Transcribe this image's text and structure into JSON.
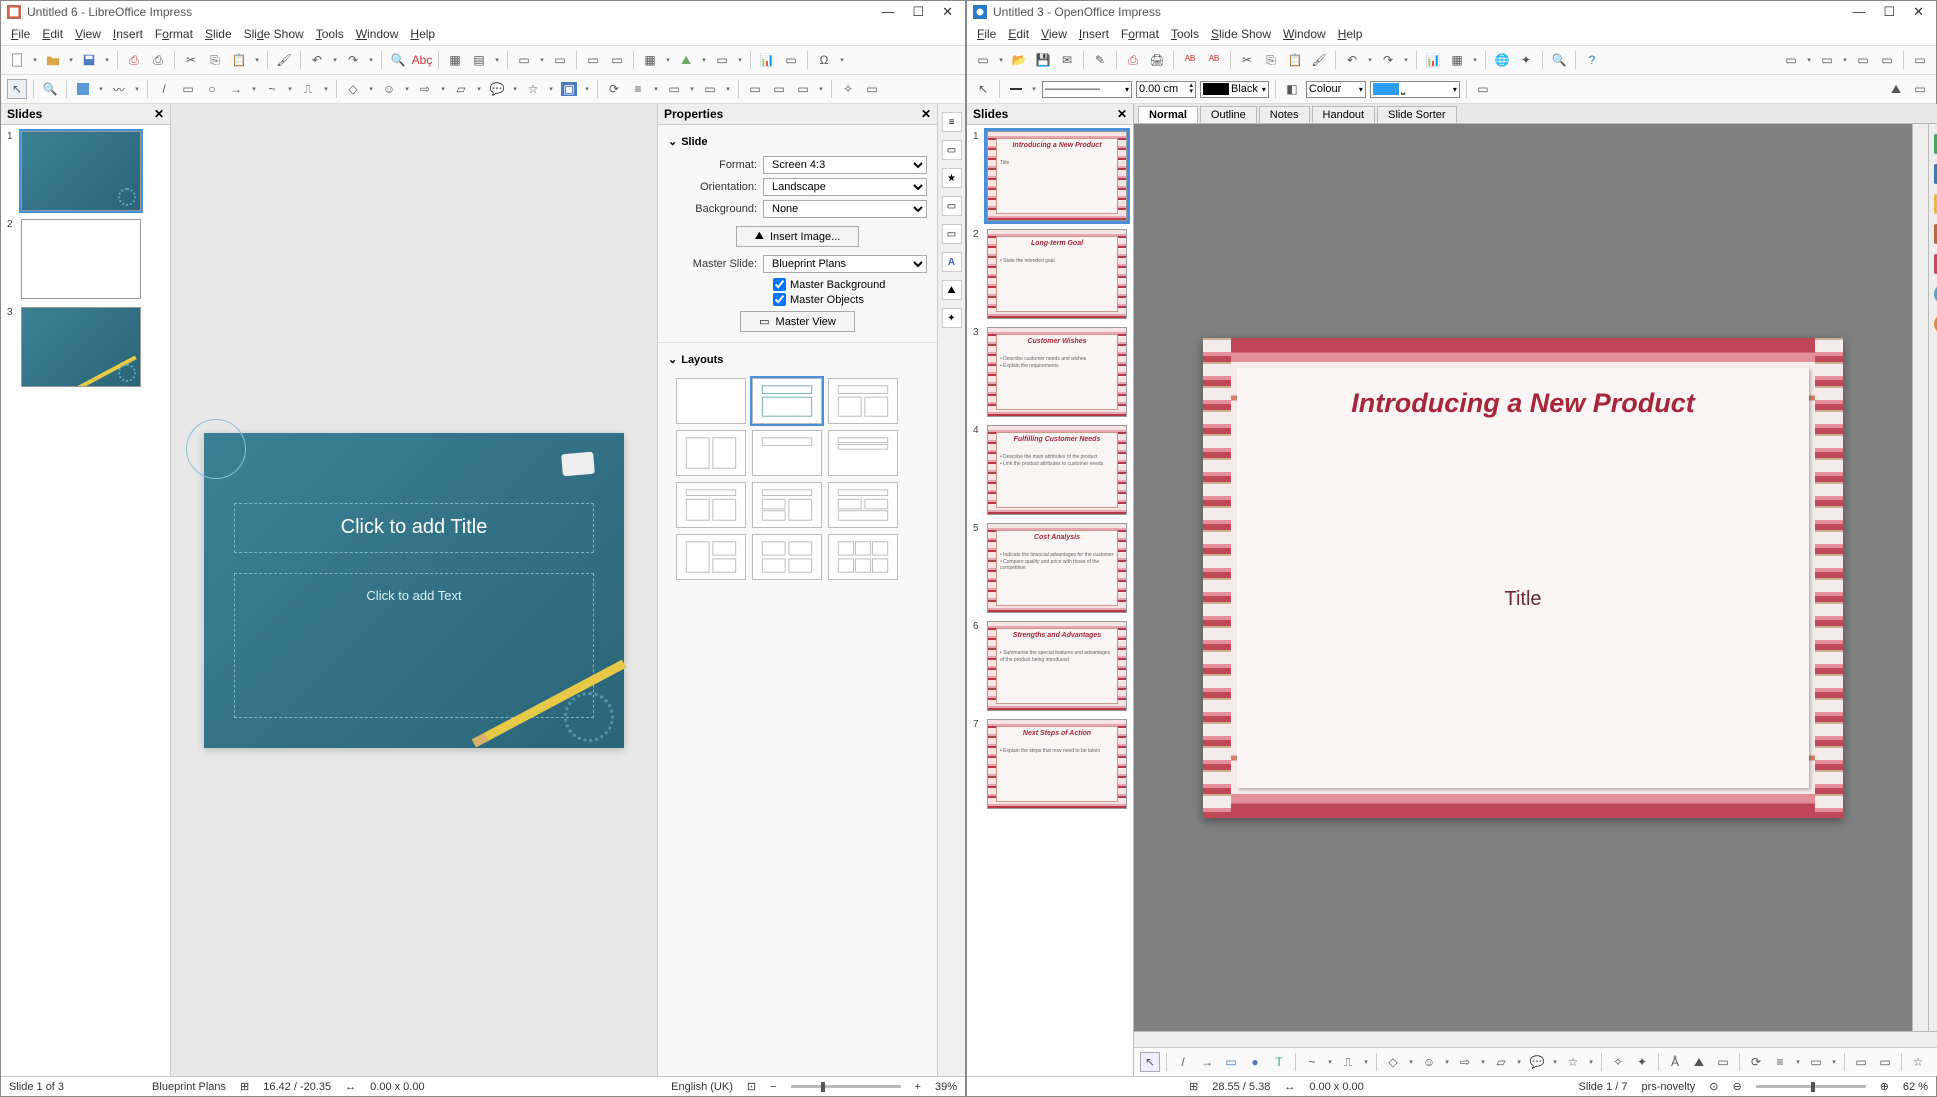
{
  "left": {
    "title": "Untitled 6 - LibreOffice Impress",
    "menu": [
      "File",
      "Edit",
      "View",
      "Insert",
      "Format",
      "Slide",
      "Slide Show",
      "Tools",
      "Window",
      "Help"
    ],
    "slides_panel_title": "Slides",
    "slide_count": 3,
    "canvas": {
      "title_ph": "Click to add Title",
      "text_ph": "Click to add Text"
    },
    "properties": {
      "panel_title": "Properties",
      "slide_section": "Slide",
      "format_label": "Format:",
      "format_value": "Screen 4:3",
      "orientation_label": "Orientation:",
      "orientation_value": "Landscape",
      "background_label": "Background:",
      "background_value": "None",
      "insert_image": "Insert Image...",
      "master_slide_label": "Master Slide:",
      "master_slide_value": "Blueprint Plans",
      "master_bg": "Master Background",
      "master_obj": "Master Objects",
      "master_view": "Master View",
      "layouts_section": "Layouts"
    },
    "status": {
      "slide": "Slide 1 of 3",
      "template": "Blueprint Plans",
      "pos": "16.42 / -20.35",
      "size": "0.00 x 0.00",
      "lang": "English (UK)",
      "zoom": "39%"
    }
  },
  "right": {
    "title": "Untitled 3 - OpenOffice Impress",
    "menu": [
      "File",
      "Edit",
      "View",
      "Insert",
      "Format",
      "Tools",
      "Slide Show",
      "Window",
      "Help"
    ],
    "slides_panel_title": "Slides",
    "tb2": {
      "line_width": "0.00 cm",
      "line_color": "Black",
      "fill_label": "Colour",
      "fill_color_code": "#2e9df7"
    },
    "tabs": [
      "Normal",
      "Outline",
      "Notes",
      "Handout",
      "Slide Sorter"
    ],
    "active_tab": "Normal",
    "slides": [
      {
        "title": "Introducing a New Product",
        "body": "Title"
      },
      {
        "title": "Long-term Goal",
        "body": "• State the intended goal"
      },
      {
        "title": "Customer Wishes",
        "body": "• Describe customer needs and wishes\n• Explain the requirements"
      },
      {
        "title": "Fulfilling Customer Needs",
        "body": "• Describe the main attributes of the product\n• Link the product attributes to customer needs"
      },
      {
        "title": "Cost Analysis",
        "body": "• Indicate the financial advantages for the customer\n• Compare quality and price with those of the competition"
      },
      {
        "title": "Strengths and Advantages",
        "body": "• Summarise the special features and advantages of the product being introduced"
      },
      {
        "title": "Next Steps of Action",
        "body": "• Explain the steps that now need to be taken"
      }
    ],
    "canvas": {
      "title": "Introducing a New Product",
      "subtitle": "Title"
    },
    "status": {
      "pos": "28.55 / 5.38",
      "size": "0.00 x 0.00",
      "slide": "Slide 1 / 7",
      "template": "prs-novelty",
      "zoom": "62 %"
    }
  }
}
